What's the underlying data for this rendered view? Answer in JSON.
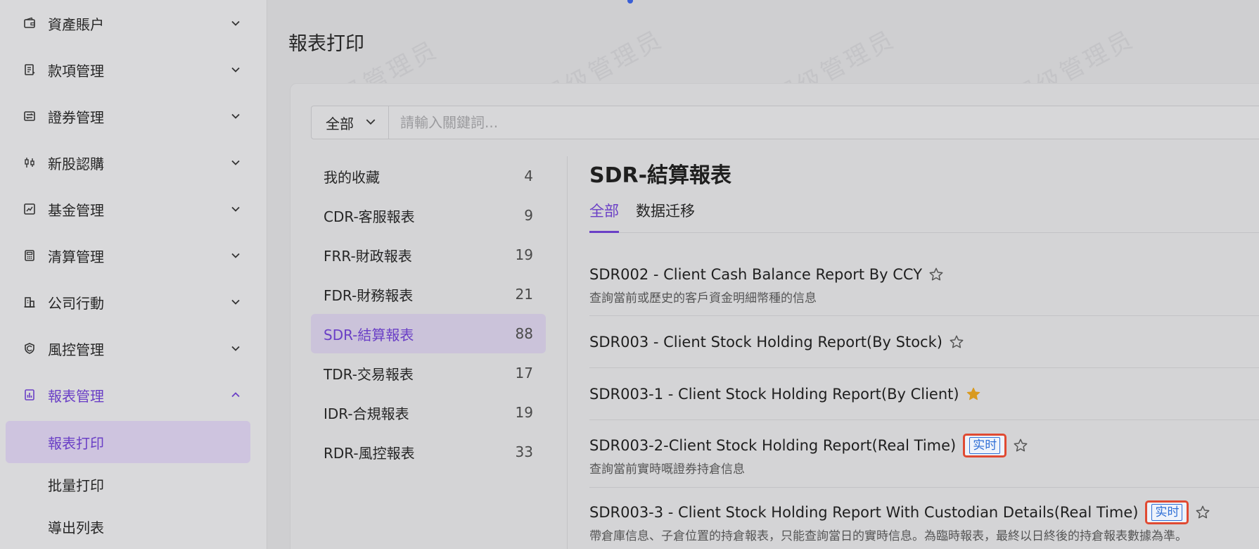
{
  "sidebar": {
    "items": [
      {
        "label": "資產賬户",
        "icon": "wallet-icon",
        "expanded": false
      },
      {
        "label": "款項管理",
        "icon": "ledger-icon",
        "expanded": false
      },
      {
        "label": "證券管理",
        "icon": "exchange-icon",
        "expanded": false
      },
      {
        "label": "新股認購",
        "icon": "candlestick-icon",
        "expanded": false
      },
      {
        "label": "基金管理",
        "icon": "chart-line-icon",
        "expanded": false
      },
      {
        "label": "清算管理",
        "icon": "calculator-icon",
        "expanded": false
      },
      {
        "label": "公司行動",
        "icon": "building-icon",
        "expanded": false
      },
      {
        "label": "風控管理",
        "icon": "shield-icon",
        "expanded": false
      },
      {
        "label": "報表管理",
        "icon": "report-chart-icon",
        "expanded": true
      }
    ],
    "subitems": [
      {
        "label": "報表打印",
        "active": true
      },
      {
        "label": "批量打印",
        "active": false
      },
      {
        "label": "導出列表",
        "active": false
      }
    ]
  },
  "page": {
    "title": "報表打印"
  },
  "search": {
    "scope": "全部",
    "placeholder": "請輸入關鍵詞..."
  },
  "categories": [
    {
      "label": "我的收藏",
      "count": "4"
    },
    {
      "label": "CDR-客服報表",
      "count": "9"
    },
    {
      "label": "FRR-財政報表",
      "count": "19"
    },
    {
      "label": "FDR-財務報表",
      "count": "21"
    },
    {
      "label": "SDR-結算報表",
      "count": "88"
    },
    {
      "label": "TDR-交易報表",
      "count": "17"
    },
    {
      "label": "IDR-合規報表",
      "count": "19"
    },
    {
      "label": "RDR-風控報表",
      "count": "33"
    }
  ],
  "active_category": "SDR-結算報表",
  "section": {
    "title": "SDR-結算報表"
  },
  "tabs": [
    {
      "label": "全部",
      "active": true
    },
    {
      "label": "数据迁移",
      "active": false
    }
  ],
  "reports": [
    {
      "title": "SDR002 - Client Cash Balance Report By CCY",
      "desc": "查詢當前或歷史的客戶資金明細幣種的信息",
      "badge": "",
      "favorite": false
    },
    {
      "title": "SDR003 - Client Stock Holding Report(By Stock)",
      "desc": "",
      "badge": "",
      "favorite": false
    },
    {
      "title": "SDR003-1 - Client Stock Holding Report(By Client)",
      "desc": "",
      "badge": "",
      "favorite": true
    },
    {
      "title": "SDR003-2-Client Stock Holding Report(Real Time)",
      "desc": "查詢當前實時嘅證券持倉信息",
      "badge": "实时",
      "favorite": false
    },
    {
      "title": "SDR003-3 - Client Stock Holding Report With Custodian Details(Real Time)",
      "desc": "帶倉庫信息、子倉位置的持倉報表，只能查詢當日的實時信息。為臨時報表，最終以日終後的持倉報表數據為準。",
      "badge": "实时",
      "favorite": false
    }
  ],
  "watermark": "超级管理员",
  "colors": {
    "accent": "#6a3fc6",
    "badge_border": "#e04a32",
    "badge_text": "#2f6fd6",
    "favorite_star": "#d99a1e"
  }
}
